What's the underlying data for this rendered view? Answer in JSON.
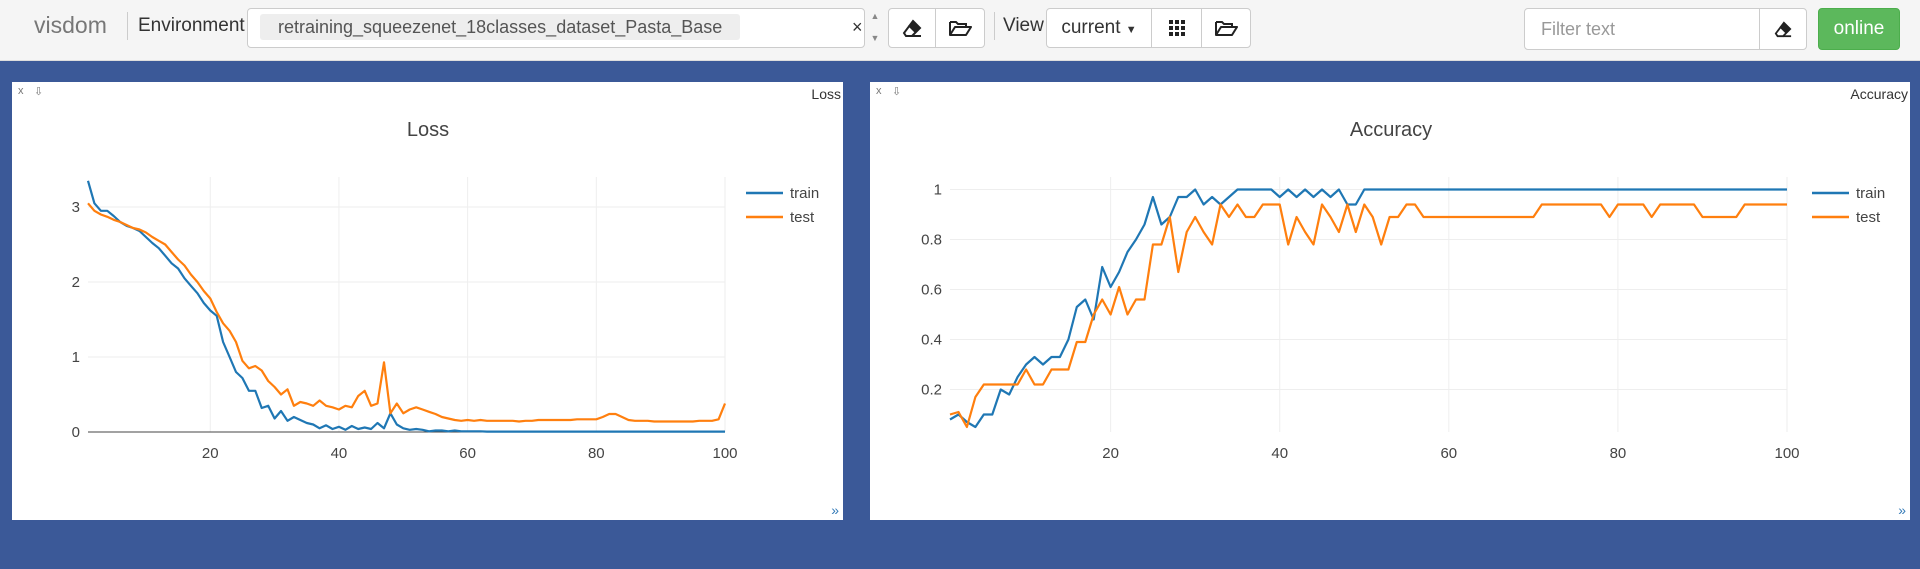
{
  "header": {
    "brand": "visdom",
    "environment_label": "Environment",
    "environment_value": "retraining_squeezenet_18classes_dataset_Pasta_Base",
    "environment_clear": "×",
    "view_label": "View",
    "view_value": "current",
    "filter_placeholder": "Filter text",
    "status": "online",
    "colors": {
      "status": "#5cb85c",
      "background": "#3b5998"
    },
    "icons": [
      "eraser-icon",
      "folder-open-icon",
      "grid-icon",
      "folder-open-icon",
      "eraser-icon"
    ]
  },
  "panes": [
    {
      "name": "Loss",
      "close": "x",
      "download": "⇩",
      "resize": "»"
    },
    {
      "name": "Accuracy",
      "close": "x",
      "download": "⇩",
      "resize": "»"
    }
  ],
  "chart_data": [
    {
      "type": "line",
      "title": "Loss",
      "xlabel": "",
      "ylabel": "",
      "xlim": [
        1,
        100
      ],
      "ylim": [
        0,
        3.4
      ],
      "xticks": [
        20,
        40,
        60,
        80,
        100
      ],
      "yticks": [
        0,
        1,
        2,
        3
      ],
      "grid": true,
      "legend": "top-right",
      "x": [
        1,
        2,
        3,
        4,
        5,
        6,
        7,
        8,
        9,
        10,
        11,
        12,
        13,
        14,
        15,
        16,
        17,
        18,
        19,
        20,
        21,
        22,
        23,
        24,
        25,
        26,
        27,
        28,
        29,
        30,
        31,
        32,
        33,
        34,
        35,
        36,
        37,
        38,
        39,
        40,
        41,
        42,
        43,
        44,
        45,
        46,
        47,
        48,
        49,
        50,
        51,
        52,
        53,
        54,
        55,
        56,
        57,
        58,
        59,
        60,
        61,
        62,
        63,
        64,
        65,
        66,
        67,
        68,
        69,
        70,
        71,
        72,
        73,
        74,
        75,
        76,
        77,
        78,
        79,
        80,
        81,
        82,
        83,
        84,
        85,
        86,
        87,
        88,
        89,
        90,
        91,
        92,
        93,
        94,
        95,
        96,
        97,
        98,
        99,
        100
      ],
      "series": [
        {
          "name": "train",
          "color": "#1f77b4",
          "values": [
            3.35,
            3.05,
            2.95,
            2.95,
            2.88,
            2.8,
            2.75,
            2.72,
            2.68,
            2.6,
            2.52,
            2.45,
            2.35,
            2.25,
            2.18,
            2.05,
            1.95,
            1.85,
            1.72,
            1.62,
            1.55,
            1.2,
            1.0,
            0.8,
            0.72,
            0.55,
            0.55,
            0.32,
            0.35,
            0.18,
            0.28,
            0.15,
            0.2,
            0.16,
            0.12,
            0.1,
            0.05,
            0.09,
            0.04,
            0.07,
            0.03,
            0.08,
            0.04,
            0.06,
            0.04,
            0.12,
            0.05,
            0.25,
            0.1,
            0.05,
            0.03,
            0.04,
            0.03,
            0.01,
            0.02,
            0.02,
            0.01,
            0.02,
            0.01,
            0.01,
            0.01,
            0.01,
            0.005,
            0.005,
            0.005,
            0.005,
            0.005,
            0.005,
            0.005,
            0.005,
            0.005,
            0.005,
            0.005,
            0.005,
            0.005,
            0.005,
            0.005,
            0.005,
            0.005,
            0.005,
            0.005,
            0.005,
            0.005,
            0.005,
            0.005,
            0.005,
            0.005,
            0.005,
            0.005,
            0.005,
            0.005,
            0.005,
            0.005,
            0.005,
            0.005,
            0.005,
            0.005,
            0.005,
            0.005,
            0.005
          ]
        },
        {
          "name": "test",
          "color": "#ff7f0e",
          "values": [
            3.05,
            2.95,
            2.9,
            2.87,
            2.83,
            2.8,
            2.76,
            2.72,
            2.7,
            2.66,
            2.6,
            2.55,
            2.5,
            2.4,
            2.3,
            2.22,
            2.1,
            2.0,
            1.88,
            1.78,
            1.6,
            1.45,
            1.35,
            1.2,
            0.95,
            0.85,
            0.88,
            0.82,
            0.68,
            0.6,
            0.5,
            0.57,
            0.35,
            0.4,
            0.38,
            0.35,
            0.42,
            0.35,
            0.33,
            0.3,
            0.35,
            0.33,
            0.48,
            0.55,
            0.35,
            0.38,
            0.93,
            0.25,
            0.38,
            0.25,
            0.3,
            0.33,
            0.3,
            0.27,
            0.24,
            0.2,
            0.18,
            0.16,
            0.15,
            0.16,
            0.15,
            0.16,
            0.15,
            0.15,
            0.15,
            0.15,
            0.15,
            0.14,
            0.15,
            0.15,
            0.16,
            0.16,
            0.16,
            0.16,
            0.16,
            0.16,
            0.17,
            0.17,
            0.17,
            0.17,
            0.2,
            0.24,
            0.24,
            0.2,
            0.16,
            0.15,
            0.15,
            0.15,
            0.14,
            0.14,
            0.14,
            0.14,
            0.14,
            0.14,
            0.14,
            0.15,
            0.15,
            0.15,
            0.17,
            0.38
          ]
        }
      ]
    },
    {
      "type": "line",
      "title": "Accuracy",
      "xlabel": "",
      "ylabel": "",
      "xlim": [
        1,
        100
      ],
      "ylim": [
        0.03,
        1.05
      ],
      "xticks": [
        20,
        40,
        60,
        80,
        100
      ],
      "yticks": [
        0.2,
        0.4,
        0.6,
        0.8,
        1
      ],
      "grid": true,
      "legend": "top-right",
      "x": [
        1,
        2,
        3,
        4,
        5,
        6,
        7,
        8,
        9,
        10,
        11,
        12,
        13,
        14,
        15,
        16,
        17,
        18,
        19,
        20,
        21,
        22,
        23,
        24,
        25,
        26,
        27,
        28,
        29,
        30,
        31,
        32,
        33,
        34,
        35,
        36,
        37,
        38,
        39,
        40,
        41,
        42,
        43,
        44,
        45,
        46,
        47,
        48,
        49,
        50,
        51,
        52,
        53,
        54,
        55,
        56,
        57,
        58,
        59,
        60,
        61,
        62,
        63,
        64,
        65,
        66,
        67,
        68,
        69,
        70,
        71,
        72,
        73,
        74,
        75,
        76,
        77,
        78,
        79,
        80,
        81,
        82,
        83,
        84,
        85,
        86,
        87,
        88,
        89,
        90,
        91,
        92,
        93,
        94,
        95,
        96,
        97,
        98,
        99,
        100
      ],
      "series": [
        {
          "name": "train",
          "color": "#1f77b4",
          "values": [
            0.08,
            0.1,
            0.07,
            0.05,
            0.1,
            0.1,
            0.2,
            0.18,
            0.25,
            0.3,
            0.33,
            0.3,
            0.33,
            0.33,
            0.4,
            0.53,
            0.56,
            0.48,
            0.69,
            0.61,
            0.67,
            0.75,
            0.8,
            0.86,
            0.97,
            0.86,
            0.89,
            0.97,
            0.97,
            1.0,
            0.94,
            0.97,
            0.94,
            0.97,
            1.0,
            1.0,
            1.0,
            1.0,
            1.0,
            0.97,
            1.0,
            0.97,
            1.0,
            0.97,
            1.0,
            0.97,
            1.0,
            0.94,
            0.94,
            1.0,
            1.0,
            1.0,
            1.0,
            1.0,
            1.0,
            1.0,
            1.0,
            1.0,
            1.0,
            1.0,
            1.0,
            1.0,
            1.0,
            1.0,
            1.0,
            1.0,
            1.0,
            1.0,
            1.0,
            1.0,
            1.0,
            1.0,
            1.0,
            1.0,
            1.0,
            1.0,
            1.0,
            1.0,
            1.0,
            1.0,
            1.0,
            1.0,
            1.0,
            1.0,
            1.0,
            1.0,
            1.0,
            1.0,
            1.0,
            1.0,
            1.0,
            1.0,
            1.0,
            1.0,
            1.0,
            1.0,
            1.0,
            1.0,
            1.0,
            1.0
          ]
        },
        {
          "name": "test",
          "color": "#ff7f0e",
          "values": [
            0.1,
            0.11,
            0.05,
            0.17,
            0.22,
            0.22,
            0.22,
            0.22,
            0.22,
            0.28,
            0.22,
            0.22,
            0.28,
            0.28,
            0.28,
            0.39,
            0.39,
            0.5,
            0.56,
            0.5,
            0.61,
            0.5,
            0.56,
            0.56,
            0.78,
            0.78,
            0.89,
            0.67,
            0.83,
            0.89,
            0.83,
            0.78,
            0.94,
            0.89,
            0.94,
            0.89,
            0.89,
            0.94,
            0.94,
            0.94,
            0.78,
            0.89,
            0.83,
            0.78,
            0.94,
            0.89,
            0.83,
            0.94,
            0.83,
            0.94,
            0.89,
            0.78,
            0.89,
            0.89,
            0.94,
            0.94,
            0.89,
            0.89,
            0.89,
            0.89,
            0.89,
            0.89,
            0.89,
            0.89,
            0.89,
            0.89,
            0.89,
            0.89,
            0.89,
            0.89,
            0.94,
            0.94,
            0.94,
            0.94,
            0.94,
            0.94,
            0.94,
            0.94,
            0.89,
            0.94,
            0.94,
            0.94,
            0.94,
            0.89,
            0.94,
            0.94,
            0.94,
            0.94,
            0.94,
            0.89,
            0.89,
            0.89,
            0.89,
            0.89,
            0.94,
            0.94,
            0.94,
            0.94,
            0.94,
            0.94
          ]
        }
      ]
    }
  ]
}
